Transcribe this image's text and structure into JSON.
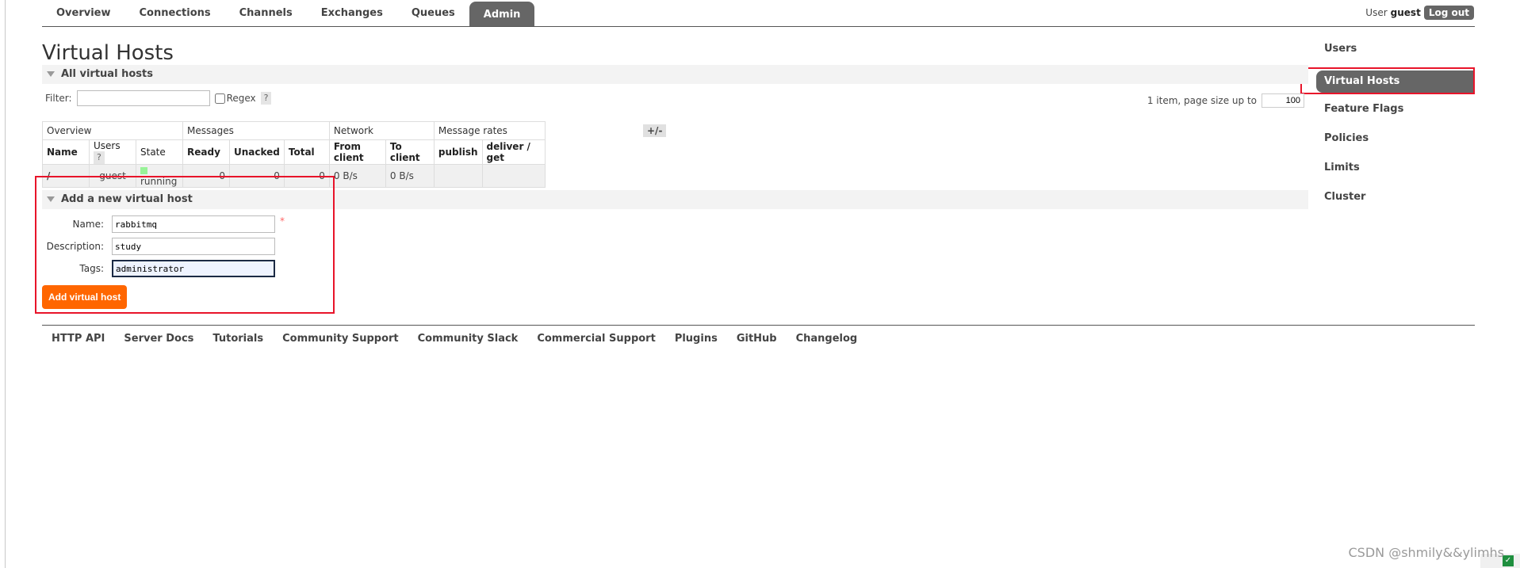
{
  "nav": {
    "tabs": [
      {
        "label": "Overview"
      },
      {
        "label": "Connections"
      },
      {
        "label": "Channels"
      },
      {
        "label": "Exchanges"
      },
      {
        "label": "Queues"
      },
      {
        "label": "Admin"
      }
    ],
    "user_label": "User",
    "user_name": "guest",
    "logout_label": "Log out"
  },
  "right_menu": {
    "items": [
      {
        "label": "Users"
      },
      {
        "label": "Virtual Hosts"
      },
      {
        "label": "Feature Flags"
      },
      {
        "label": "Policies"
      },
      {
        "label": "Limits"
      },
      {
        "label": "Cluster"
      }
    ]
  },
  "page": {
    "title": "Virtual Hosts"
  },
  "all_vhosts": {
    "section_title": "All virtual hosts",
    "filter_label": "Filter:",
    "filter_value": "",
    "regex_label": "Regex",
    "help_label": "?",
    "paging_text": "1 item, page size up to",
    "page_size": "100",
    "plus_minus": "+/-",
    "table": {
      "groups": [
        "Overview",
        "Messages",
        "Network",
        "Message rates"
      ],
      "columns": [
        "Name",
        "Users",
        "State",
        "Ready",
        "Unacked",
        "Total",
        "From client",
        "To client",
        "publish",
        "deliver / get"
      ],
      "rows": [
        {
          "name": "/",
          "users": "guest",
          "state": "running",
          "ready": "0",
          "unacked": "0",
          "total": "0",
          "from_client": "0 B/s",
          "to_client": "0 B/s",
          "publish": "",
          "deliver_get": ""
        }
      ]
    }
  },
  "add_vhost": {
    "section_title": "Add a new virtual host",
    "name_label": "Name:",
    "name_value": "rabbitmq",
    "required_mark": "*",
    "description_label": "Description:",
    "description_value": "study",
    "tags_label": "Tags:",
    "tags_value": "administrator",
    "submit_label": "Add virtual host"
  },
  "footer": {
    "links": [
      {
        "label": "HTTP API"
      },
      {
        "label": "Server Docs"
      },
      {
        "label": "Tutorials"
      },
      {
        "label": "Community Support"
      },
      {
        "label": "Community Slack"
      },
      {
        "label": "Commercial Support"
      },
      {
        "label": "Plugins"
      },
      {
        "label": "GitHub"
      },
      {
        "label": "Changelog"
      }
    ]
  },
  "watermark": "CSDN @shmily&&ylimhs"
}
